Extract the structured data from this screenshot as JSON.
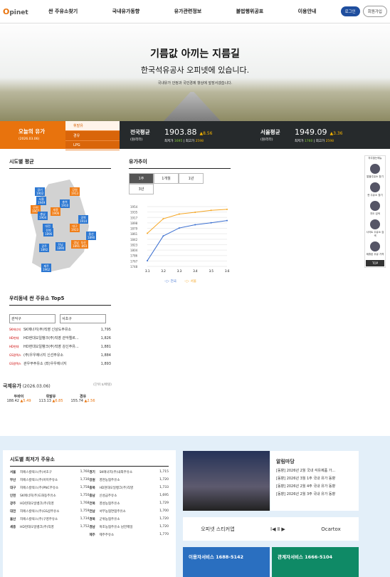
{
  "header": {
    "logo": "pinet",
    "logo_o": "O",
    "nav": [
      "싼 주유소찾기",
      "국내유가동향",
      "유가관련정보",
      "불법행위공표",
      "이용안내"
    ],
    "login": "로그인",
    "join": "회원가입"
  },
  "hero": {
    "title": "기름값 아끼는 지름길",
    "subtitle": "한국석유공사 오피넷에 있습니다.",
    "note": "국내유가 안정과 국민경제 향상에 앞장서겠습니다."
  },
  "price_bar": {
    "today": "오늘의 유가",
    "date": "(2026.03.06)",
    "fuels": [
      "휘발유",
      "경유",
      "LPG"
    ],
    "national": {
      "label": "전국평균",
      "unit": "(원/리터)",
      "price": "1903.88",
      "change": "▲8.56",
      "sub_low": "최저가",
      "low": "1695",
      "sub_high": "최고가",
      "high": "2598"
    },
    "seoul": {
      "label": "서울평균",
      "unit": "(원/리터)",
      "price": "1949.09",
      "change": "▲3.36",
      "sub_low": "최저가",
      "low": "1760",
      "sub_high": "최고가",
      "high": "2598"
    }
  },
  "side": {
    "title": "자주찾는메뉴",
    "items": [
      "알뜰주유소 찾기",
      "싼 주유소 찾기",
      "지도 검색",
      "사이트 주유소 검색",
      "제휴된 우유 가격",
      "TOP"
    ]
  },
  "region": {
    "title": "시도별 평균",
    "markers": [
      {
        "n": "강원",
        "v": "1913"
      },
      {
        "n": "경기",
        "v": "1902"
      },
      {
        "n": "서울",
        "v": "1949"
      },
      {
        "n": "인천",
        "v": "1907"
      },
      {
        "n": "충북",
        "v": "1910"
      },
      {
        "n": "충남",
        "v": "1904"
      },
      {
        "n": "세종",
        "v": "1906"
      },
      {
        "n": "대전",
        "v": "1897"
      },
      {
        "n": "경북",
        "v": "1914"
      },
      {
        "n": "대구",
        "v": "1923"
      },
      {
        "n": "울산",
        "v": "1890"
      },
      {
        "n": "전북",
        "v": "1896"
      },
      {
        "n": "부산",
        "v": "1893"
      },
      {
        "n": "광주",
        "v": "1892"
      },
      {
        "n": "전남",
        "v": "1890"
      },
      {
        "n": "경남",
        "v": "1891"
      },
      {
        "n": "제주",
        "v": "1962"
      }
    ]
  },
  "trend": {
    "title": "유가추이",
    "tabs": [
      "1주",
      "1개월",
      "1년",
      "3년"
    ],
    "legend": [
      "전국",
      "서울"
    ]
  },
  "chart_data": {
    "type": "line",
    "x": [
      "3.1",
      "3.2",
      "3.3",
      "3.4",
      "3.5",
      "3.6"
    ],
    "series": [
      {
        "name": "전국",
        "values": [
          1743,
          1842,
          1874,
          1887,
          1895,
          1904
        ]
      },
      {
        "name": "서울",
        "values": [
          1853,
          1911,
          1930,
          1937,
          1945,
          1949
        ]
      }
    ],
    "ylim": [
      1720,
      1960
    ],
    "yticks": [
      "1954",
      "1935",
      "1917",
      "1898",
      "1879",
      "1861",
      "1842",
      "1823",
      "1804",
      "1786",
      "1767",
      "1748"
    ]
  },
  "top5": {
    "title": "우리동네 싼 주유소 Top5",
    "sel1": "관악구",
    "sel2": "서초구",
    "rows": [
      {
        "b": "SK에너지",
        "n": "SK에너지(주)직영 신상도주유소",
        "p": "1,795"
      },
      {
        "b": "HD현대",
        "n": "HD현대오일뱅크(주)직영 관악엘르...",
        "p": "1,826"
      },
      {
        "b": "HD현대",
        "n": "HD현대오일뱅크(주)직영 강신주유...",
        "p": "1,881"
      },
      {
        "b": "GS칼텍스",
        "n": "(주)우우에너지 신선주유소",
        "p": "1,884"
      },
      {
        "b": "GS칼텍스",
        "n": "관우무주유소 (좌)우우에너지",
        "p": "1,893"
      }
    ]
  },
  "intl": {
    "title": "국제유가",
    "date": "(2026.03.06)",
    "unit": "(단위:$/배럴)",
    "items": [
      {
        "n": "두바이",
        "v": "188.42",
        "c": "▲5.49"
      },
      {
        "n": "휘발유",
        "v": "113.13",
        "c": "▲6.85"
      },
      {
        "n": "경유",
        "v": "155.74",
        "c": "▲2.56"
      }
    ]
  },
  "lowest": {
    "title": "시도별 최저가 주유소",
    "rows": [
      [
        "서울",
        "지에스칼텍스(주)서초구",
        "1,760",
        "경기",
        "SK에너지(주)내외주유소",
        "1,715"
      ],
      [
        "부산",
        "지에스칼텍스(주)아미주유소",
        "1,730",
        "강원",
        "영천농협주유소",
        "1,720"
      ],
      [
        "대구",
        "지에스칼텍스(주)PNC주유소",
        "1,758",
        "충북",
        "HD현대오일뱅크(주)직영",
        "1,733"
      ],
      [
        "인천",
        "SK에너지(주)도화동주유소",
        "1,750",
        "충남",
        "신성금주유소",
        "1,695"
      ],
      [
        "광주",
        "HD현대오일뱅크(주)직영",
        "1,768",
        "전북",
        "영성농협주유소",
        "1,729"
      ],
      [
        "대전",
        "지에스칼텍스(주)GS샵주유소",
        "1,759",
        "전남",
        "서부농협연합주유소",
        "1,700"
      ],
      [
        "울산",
        "지에스칼텍스(주)구영주유소",
        "1,734",
        "경북",
        "군위농협주유소",
        "1,720"
      ],
      [
        "세종",
        "HD현대오일뱅크(주)직영",
        "1,752",
        "경남",
        "왁조농협주유소 남한제일",
        "1,720"
      ],
      [
        "",
        "",
        "",
        "제주",
        "제주주유소",
        "1,770"
      ]
    ]
  },
  "notice": {
    "title": "알림마당",
    "items": [
      "[동향] 2026년 2월 국내 석유제품 가...",
      "[동향] 2026년 3월 1주 국내 유가 동향",
      "[동향] 2026년 2월 4주 국내 유가 동향",
      "[동향] 2026년 2월 3주 국내 유가 동향"
    ]
  },
  "banner": {
    "a": "오피넷 스티커앱",
    "b": "Ⅰ◀ Ⅱ ▶",
    "c": "Ocartox"
  },
  "svc": [
    {
      "t": "이용자서비스",
      "p": "1688-5142",
      "bg": "#2a6fc0"
    },
    {
      "t": "관계자서비스",
      "p": "1666-5104",
      "bg": "#0f8a66"
    }
  ]
}
